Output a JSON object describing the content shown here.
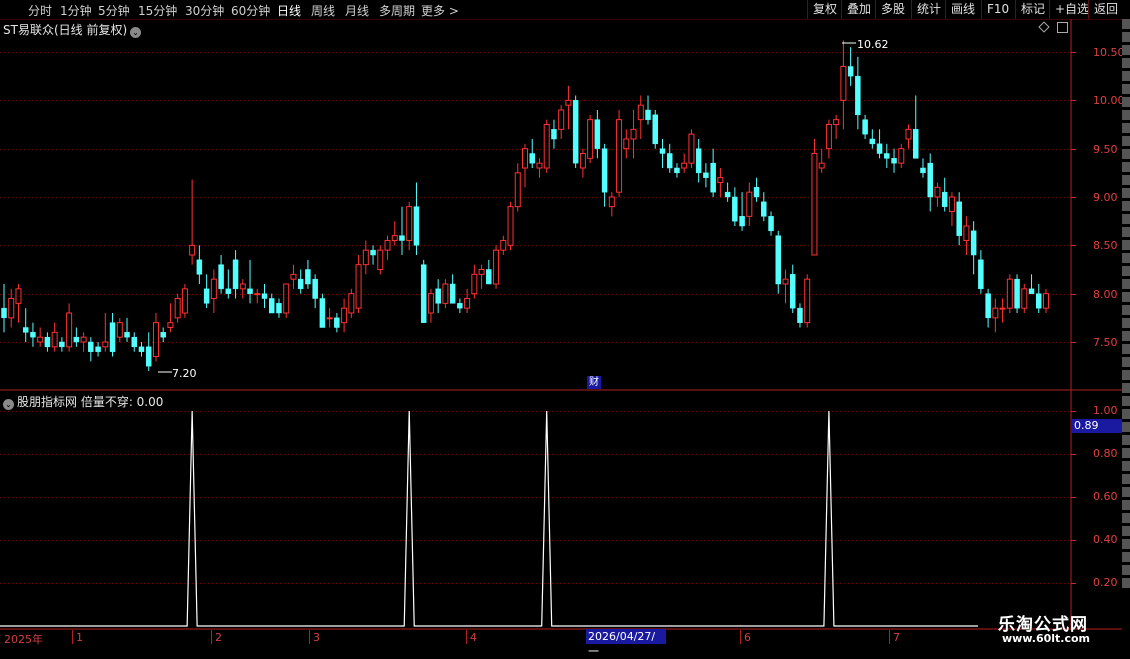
{
  "toolbar": {
    "periods": [
      "分时",
      "1分钟",
      "5分钟",
      "15分钟",
      "30分钟",
      "60分钟",
      "日线",
      "周线",
      "月线",
      "多周期",
      "更多 >"
    ],
    "right_buttons": [
      "复权",
      "叠加",
      "多股",
      "统计",
      "画线",
      "F10",
      "标记",
      "+自选",
      "返回"
    ]
  },
  "main_chart": {
    "title": "ST易联众(日线 前复权)",
    "y_labels": [
      "10.50",
      "10.00",
      "9.50",
      "9.00",
      "8.50",
      "8.00",
      "7.50"
    ],
    "max_label": "10.62",
    "min_label": "7.20",
    "finance_marker": "财"
  },
  "indicator": {
    "title": "股朋指标网 倍量不穿: 0.00",
    "y_labels": [
      "1.00",
      "0.80",
      "0.60",
      "0.40",
      "0.20"
    ],
    "current_value": "0.89"
  },
  "x_axis": {
    "year": "2025年",
    "months": [
      "1",
      "2",
      "3",
      "4",
      "6",
      "7"
    ],
    "cursor_date": "2026/04/27/一"
  },
  "watermark": {
    "line1": "乐淘公式网",
    "line2": "www.60lt.com"
  },
  "chart_data": {
    "type": "candlestick",
    "title": "ST易联众(日线 前复权)",
    "ylim": [
      7.05,
      10.82
    ],
    "ohlc": [
      [
        7.85,
        8.1,
        7.6,
        7.75
      ],
      [
        7.75,
        8.05,
        7.65,
        7.95
      ],
      [
        7.9,
        8.1,
        7.7,
        8.05
      ],
      [
        7.65,
        7.85,
        7.5,
        7.6
      ],
      [
        7.6,
        7.7,
        7.45,
        7.55
      ],
      [
        7.5,
        7.65,
        7.45,
        7.55
      ],
      [
        7.55,
        7.6,
        7.4,
        7.45
      ],
      [
        7.45,
        7.7,
        7.4,
        7.6
      ],
      [
        7.5,
        7.55,
        7.4,
        7.45
      ],
      [
        7.45,
        7.9,
        7.4,
        7.8
      ],
      [
        7.55,
        7.65,
        7.45,
        7.5
      ],
      [
        7.5,
        7.6,
        7.4,
        7.55
      ],
      [
        7.5,
        7.55,
        7.3,
        7.4
      ],
      [
        7.45,
        7.5,
        7.35,
        7.4
      ],
      [
        7.45,
        7.8,
        7.4,
        7.5
      ],
      [
        7.7,
        7.8,
        7.35,
        7.4
      ],
      [
        7.55,
        7.75,
        7.5,
        7.7
      ],
      [
        7.6,
        7.75,
        7.5,
        7.55
      ],
      [
        7.55,
        7.6,
        7.4,
        7.45
      ],
      [
        7.45,
        7.5,
        7.35,
        7.4
      ],
      [
        7.45,
        7.6,
        7.2,
        7.25
      ],
      [
        7.35,
        7.8,
        7.3,
        7.7
      ],
      [
        7.6,
        7.65,
        7.5,
        7.55
      ],
      [
        7.65,
        7.9,
        7.6,
        7.7
      ],
      [
        7.75,
        8.0,
        7.7,
        7.95
      ],
      [
        7.8,
        8.1,
        7.75,
        8.05
      ],
      [
        8.4,
        9.18,
        8.3,
        8.5
      ],
      [
        8.35,
        8.5,
        8.1,
        8.2
      ],
      [
        8.05,
        8.2,
        7.85,
        7.9
      ],
      [
        7.95,
        8.25,
        7.8,
        8.15
      ],
      [
        8.3,
        8.4,
        8.0,
        8.05
      ],
      [
        8.05,
        8.25,
        7.95,
        8.0
      ],
      [
        8.35,
        8.45,
        7.95,
        8.05
      ],
      [
        8.05,
        8.15,
        7.95,
        8.1
      ],
      [
        8.05,
        8.35,
        7.9,
        8.0
      ],
      [
        8.0,
        8.05,
        7.9,
        8.0
      ],
      [
        8.0,
        8.1,
        7.85,
        7.95
      ],
      [
        7.95,
        8.0,
        7.8,
        7.8
      ],
      [
        7.9,
        7.95,
        7.75,
        7.8
      ],
      [
        7.8,
        8.1,
        7.75,
        8.1
      ],
      [
        8.15,
        8.3,
        8.05,
        8.2
      ],
      [
        8.15,
        8.25,
        8.0,
        8.05
      ],
      [
        8.25,
        8.35,
        8.05,
        8.1
      ],
      [
        8.15,
        8.2,
        7.85,
        7.95
      ],
      [
        7.95,
        8.0,
        7.65,
        7.65
      ],
      [
        7.75,
        7.85,
        7.65,
        7.75
      ],
      [
        7.75,
        7.8,
        7.6,
        7.65
      ],
      [
        7.7,
        7.95,
        7.6,
        7.85
      ],
      [
        7.8,
        8.05,
        7.75,
        8.0
      ],
      [
        7.85,
        8.4,
        7.8,
        8.3
      ],
      [
        8.3,
        8.55,
        8.2,
        8.45
      ],
      [
        8.45,
        8.5,
        8.3,
        8.4
      ],
      [
        8.25,
        8.5,
        8.2,
        8.45
      ],
      [
        8.45,
        8.6,
        8.35,
        8.55
      ],
      [
        8.55,
        8.75,
        8.5,
        8.6
      ],
      [
        8.6,
        8.9,
        8.4,
        8.55
      ],
      [
        8.55,
        8.95,
        8.45,
        8.9
      ],
      [
        8.9,
        9.15,
        8.4,
        8.5
      ],
      [
        8.3,
        8.35,
        7.7,
        7.7
      ],
      [
        7.8,
        8.05,
        7.7,
        8.0
      ],
      [
        8.05,
        8.15,
        7.8,
        7.9
      ],
      [
        7.9,
        8.15,
        7.85,
        8.1
      ],
      [
        8.1,
        8.2,
        7.9,
        7.9
      ],
      [
        7.9,
        7.95,
        7.8,
        7.85
      ],
      [
        7.85,
        8.05,
        7.8,
        7.95
      ],
      [
        8.0,
        8.3,
        7.95,
        8.2
      ],
      [
        8.2,
        8.3,
        8.05,
        8.25
      ],
      [
        8.25,
        8.35,
        8.1,
        8.1
      ],
      [
        8.1,
        8.5,
        8.05,
        8.45
      ],
      [
        8.45,
        8.6,
        8.4,
        8.55
      ],
      [
        8.5,
        8.95,
        8.45,
        8.9
      ],
      [
        8.9,
        9.35,
        8.85,
        9.25
      ],
      [
        9.3,
        9.55,
        9.1,
        9.5
      ],
      [
        9.45,
        9.6,
        9.3,
        9.35
      ],
      [
        9.3,
        9.4,
        9.2,
        9.35
      ],
      [
        9.3,
        9.8,
        9.25,
        9.75
      ],
      [
        9.7,
        9.8,
        9.5,
        9.6
      ],
      [
        9.7,
        9.95,
        9.6,
        9.9
      ],
      [
        9.95,
        10.15,
        9.7,
        10.0
      ],
      [
        10.0,
        10.05,
        9.3,
        9.35
      ],
      [
        9.3,
        9.5,
        9.2,
        9.45
      ],
      [
        9.4,
        9.85,
        9.35,
        9.8
      ],
      [
        9.8,
        9.9,
        9.4,
        9.5
      ],
      [
        9.5,
        9.55,
        8.9,
        9.05
      ],
      [
        8.9,
        9.05,
        8.8,
        9.0
      ],
      [
        9.05,
        9.9,
        9.0,
        9.8
      ],
      [
        9.5,
        9.7,
        9.4,
        9.6
      ],
      [
        9.6,
        9.9,
        9.4,
        9.7
      ],
      [
        9.8,
        10.05,
        9.6,
        9.95
      ],
      [
        9.9,
        10.05,
        9.75,
        9.8
      ],
      [
        9.85,
        9.9,
        9.5,
        9.55
      ],
      [
        9.5,
        9.6,
        9.3,
        9.45
      ],
      [
        9.45,
        9.55,
        9.25,
        9.3
      ],
      [
        9.3,
        9.35,
        9.2,
        9.25
      ],
      [
        9.3,
        9.45,
        9.25,
        9.35
      ],
      [
        9.35,
        9.7,
        9.3,
        9.65
      ],
      [
        9.5,
        9.6,
        9.15,
        9.25
      ],
      [
        9.25,
        9.35,
        9.1,
        9.2
      ],
      [
        9.35,
        9.5,
        9.0,
        9.05
      ],
      [
        9.15,
        9.3,
        9.0,
        9.2
      ],
      [
        9.05,
        9.15,
        8.95,
        9.0
      ],
      [
        9.0,
        9.1,
        8.7,
        8.75
      ],
      [
        8.8,
        9.05,
        8.65,
        8.7
      ],
      [
        8.8,
        9.15,
        8.7,
        9.05
      ],
      [
        9.1,
        9.2,
        8.95,
        9.0
      ],
      [
        8.95,
        9.05,
        8.75,
        8.8
      ],
      [
        8.8,
        8.85,
        8.6,
        8.65
      ],
      [
        8.6,
        8.65,
        8.0,
        8.1
      ],
      [
        8.1,
        8.25,
        7.9,
        8.15
      ],
      [
        8.2,
        8.3,
        7.8,
        7.85
      ],
      [
        7.85,
        7.9,
        7.65,
        7.7
      ],
      [
        7.7,
        8.2,
        7.65,
        8.15
      ],
      [
        8.4,
        9.6,
        8.4,
        9.45
      ],
      [
        9.3,
        9.5,
        9.25,
        9.35
      ],
      [
        9.5,
        9.8,
        9.4,
        9.75
      ],
      [
        9.75,
        9.85,
        9.6,
        9.8
      ],
      [
        10.0,
        10.62,
        9.7,
        10.35
      ],
      [
        10.35,
        10.55,
        10.15,
        10.25
      ],
      [
        10.25,
        10.45,
        9.7,
        9.85
      ],
      [
        9.8,
        9.85,
        9.6,
        9.65
      ],
      [
        9.6,
        9.7,
        9.5,
        9.55
      ],
      [
        9.55,
        9.7,
        9.4,
        9.45
      ],
      [
        9.45,
        9.55,
        9.3,
        9.4
      ],
      [
        9.4,
        9.5,
        9.25,
        9.35
      ],
      [
        9.35,
        9.55,
        9.3,
        9.5
      ],
      [
        9.6,
        9.75,
        9.5,
        9.7
      ],
      [
        9.7,
        10.05,
        9.4,
        9.4
      ],
      [
        9.3,
        9.4,
        9.2,
        9.25
      ],
      [
        9.35,
        9.45,
        8.85,
        9.0
      ],
      [
        9.0,
        9.15,
        8.9,
        9.1
      ],
      [
        9.05,
        9.2,
        8.85,
        8.9
      ],
      [
        8.85,
        9.05,
        8.7,
        9.0
      ],
      [
        8.95,
        9.05,
        8.5,
        8.6
      ],
      [
        8.55,
        8.8,
        8.4,
        8.7
      ],
      [
        8.65,
        8.75,
        8.2,
        8.4
      ],
      [
        8.35,
        8.45,
        8.0,
        8.05
      ],
      [
        8.0,
        8.05,
        7.65,
        7.75
      ],
      [
        7.75,
        7.95,
        7.6,
        7.85
      ],
      [
        7.85,
        7.95,
        7.7,
        7.85
      ],
      [
        7.85,
        8.2,
        7.8,
        8.15
      ],
      [
        8.15,
        8.2,
        7.8,
        7.85
      ],
      [
        7.85,
        8.1,
        7.8,
        8.05
      ],
      [
        8.05,
        8.2,
        8.0,
        8.0
      ],
      [
        8.0,
        8.1,
        7.8,
        7.85
      ],
      [
        7.85,
        8.05,
        7.8,
        8.0
      ]
    ],
    "indicator_series": {
      "name": "倍量不穿",
      "peaks_at_index": [
        26,
        56,
        75,
        114
      ],
      "peak_value": 1.0,
      "base_value": 0.0
    }
  },
  "colors": {
    "up": "#ff3232",
    "down": "#54ffff",
    "grid": "#7a0000",
    "axis_text": "#e04040",
    "highlight_bg": "#1a1aa0"
  }
}
